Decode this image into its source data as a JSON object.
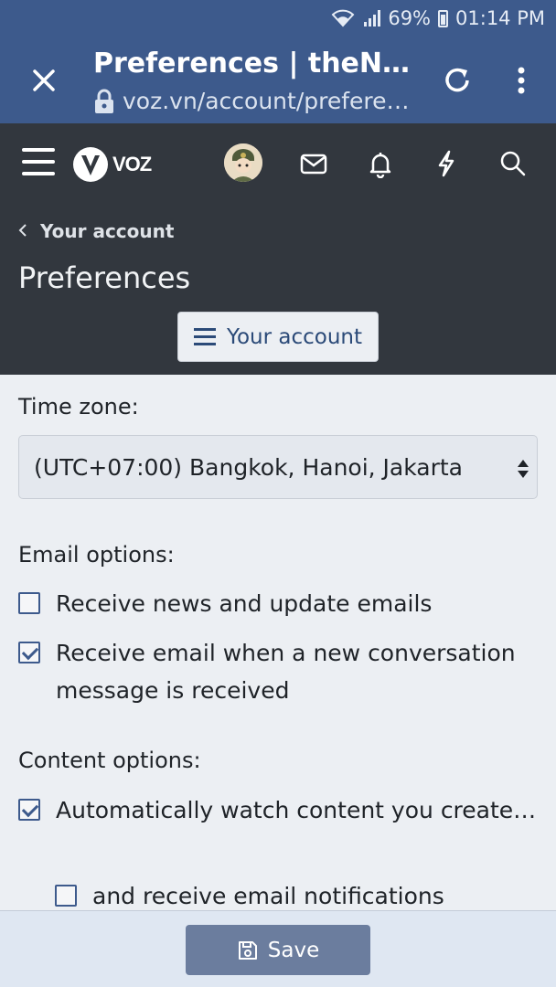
{
  "status_bar": {
    "battery": "69%",
    "time": "01:14 PM",
    "icons": [
      "wifi-icon",
      "signal-icon",
      "battery-icon"
    ]
  },
  "browser": {
    "title": "Preferences | theNEX…",
    "url": "voz.vn/account/preferen…",
    "icons": [
      "close-icon",
      "lock-icon",
      "reload-icon",
      "more-vert-icon"
    ]
  },
  "site_nav": {
    "logo_text": "VOZ",
    "icons": [
      "hamburger-icon",
      "avatar",
      "mail-icon",
      "bell-icon",
      "bolt-icon",
      "search-icon"
    ]
  },
  "header": {
    "breadcrumb": "Your account",
    "page_title": "Preferences",
    "account_button": "Your account"
  },
  "form": {
    "time_zone_label": "Time zone:",
    "time_zone_value": "(UTC+07:00) Bangkok, Hanoi, Jakarta",
    "email_options_label": "Email options:",
    "email_options": [
      {
        "label": "Receive news and update emails",
        "checked": false
      },
      {
        "label": "Receive email when a new conversation message is received",
        "checked": true
      }
    ],
    "content_options_label": "Content options:",
    "content_options": [
      {
        "label": "Automatically watch content you create…",
        "checked": true
      },
      {
        "label": "and receive email notifications",
        "checked": false
      }
    ]
  },
  "footer": {
    "save_label": "Save"
  },
  "colors": {
    "primary": "#3d5a8c",
    "header_bg": "#32373e",
    "page_bg": "#eceff3",
    "save_button": "#6b7d9e"
  }
}
